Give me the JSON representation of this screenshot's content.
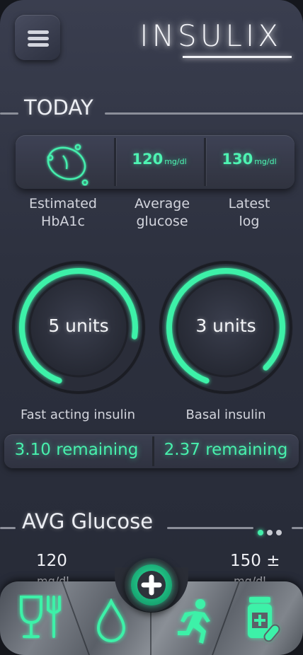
{
  "app": {
    "logo": "INSULIX"
  },
  "colors": {
    "accent": "#45f0ae",
    "background": "#2d313f",
    "nav": "#6f747c"
  },
  "today": {
    "title": "TODAY",
    "stats": [
      {
        "icon": "drop-rings-icon",
        "label": "Estimated\nHbA1c"
      },
      {
        "value": "120",
        "unit": "mg/dl",
        "label": "Average\nglucose"
      },
      {
        "value": "130",
        "unit": "mg/dl",
        "label": "Latest\nlog"
      }
    ]
  },
  "insulin": [
    {
      "text": "5 units",
      "label": "Fast acting insulin",
      "remaining": "3.10 remaining",
      "progress": 0.72
    },
    {
      "text": "3 units",
      "label": "Basal insulin",
      "remaining": "2.37 remaining",
      "progress": 0.82
    }
  ],
  "avg_glucose": {
    "title": "AVG Glucose",
    "left_value": "120",
    "left_unit": "mg/dl",
    "right_value": "150 ±",
    "right_unit": "mg/dl",
    "pages": 3,
    "active_page": 1
  },
  "nav": {
    "items": [
      {
        "icon": "meal-icon"
      },
      {
        "icon": "water-drop-icon"
      },
      {
        "icon": "running-icon"
      },
      {
        "icon": "medication-icon"
      }
    ],
    "fab_icon": "plus-icon"
  }
}
